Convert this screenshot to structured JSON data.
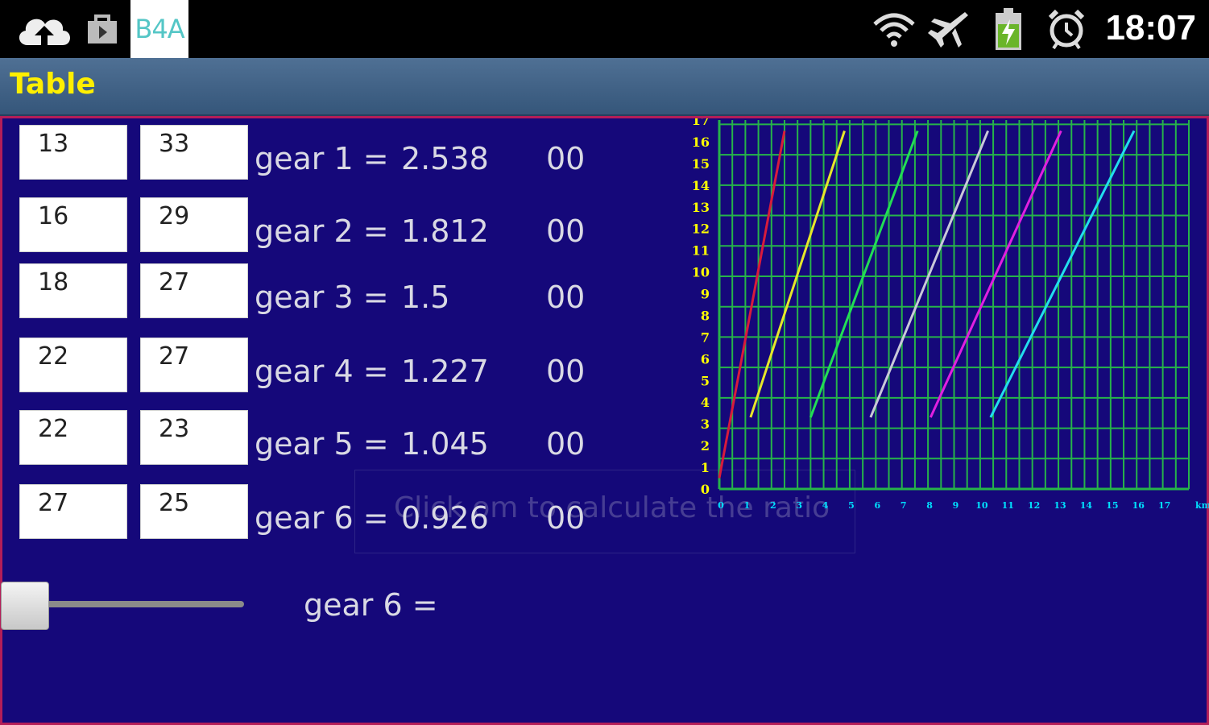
{
  "status_bar": {
    "icons": [
      "cloud-upload-icon",
      "shopping-bag-icon",
      "wifi-icon",
      "airplane-icon",
      "battery-charging-icon",
      "alarm-icon"
    ],
    "app_badge": "B4A",
    "time": "18:07"
  },
  "titlebar": {
    "title": "Table"
  },
  "gears": [
    {
      "a": "13",
      "b": "33",
      "label": "gear 1 =",
      "value": "2.538",
      "extra": "00"
    },
    {
      "a": "16",
      "b": "29",
      "label": "gear 2 =",
      "value": "1.812",
      "extra": "00"
    },
    {
      "a": "18",
      "b": "27",
      "label": "gear 3 =",
      "value": "1.5",
      "extra": "00"
    },
    {
      "a": "22",
      "b": "27",
      "label": "gear 4 =",
      "value": "1.227",
      "extra": "00"
    },
    {
      "a": "22",
      "b": "23",
      "label": "gear 5 =",
      "value": "1.045",
      "extra": "00"
    },
    {
      "a": "27",
      "b": "25",
      "label": "gear 6 =",
      "value": "0.926",
      "extra": "00"
    }
  ],
  "toast": {
    "text": "Click om to calculate the ratio"
  },
  "slider": {
    "label": "gear 6 =",
    "value": 0.0
  },
  "colors": {
    "panel_bg": "#15087a",
    "panel_border": "#b31e58",
    "grid": "#26b34a",
    "title_text": "#ffef00",
    "y_ticks": "#ffff00",
    "x_ticks": "#00e0ff"
  },
  "chart_data": {
    "type": "line",
    "title": "",
    "xlabel": "",
    "x_unit_label": "km/h",
    "ylabel": "",
    "xlim": [
      0,
      18
    ],
    "ylim": [
      0,
      17
    ],
    "x_ticks": [
      0,
      1,
      2,
      3,
      4,
      5,
      6,
      7,
      8,
      9,
      10,
      11,
      12,
      13,
      14,
      15,
      16,
      17
    ],
    "y_ticks": [
      0,
      1,
      2,
      3,
      4,
      5,
      6,
      7,
      8,
      9,
      10,
      11,
      12,
      13,
      14,
      15,
      16,
      17
    ],
    "grid": true,
    "series": [
      {
        "color": "#d81b3c",
        "points": [
          [
            0,
            0.5
          ],
          [
            2.5,
            16.5
          ]
        ]
      },
      {
        "color": "#e6e62a",
        "points": [
          [
            1.2,
            3.3
          ],
          [
            4.8,
            16.5
          ]
        ]
      },
      {
        "color": "#22dd55",
        "points": [
          [
            3.5,
            3.3
          ],
          [
            7.6,
            16.5
          ]
        ]
      },
      {
        "color": "#c8c8d8",
        "points": [
          [
            5.8,
            3.3
          ],
          [
            10.3,
            16.5
          ]
        ]
      },
      {
        "color": "#e020e0",
        "points": [
          [
            8.1,
            3.3
          ],
          [
            13.1,
            16.5
          ]
        ]
      },
      {
        "color": "#22ddee",
        "points": [
          [
            10.4,
            3.3
          ],
          [
            15.9,
            16.5
          ]
        ]
      }
    ]
  }
}
